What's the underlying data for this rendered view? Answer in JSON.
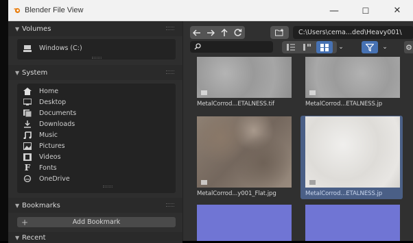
{
  "window": {
    "title": "Blender File View",
    "controls": {
      "minimize": "—",
      "maximize": "☐",
      "close": "✕"
    }
  },
  "sidebar": {
    "volumes": {
      "header": "Volumes",
      "items": [
        {
          "label": "Windows (C:)",
          "icon": "drive-icon"
        }
      ]
    },
    "system": {
      "header": "System",
      "items": [
        {
          "label": "Home",
          "icon": "home-icon"
        },
        {
          "label": "Desktop",
          "icon": "desktop-icon"
        },
        {
          "label": "Documents",
          "icon": "documents-icon"
        },
        {
          "label": "Downloads",
          "icon": "download-icon"
        },
        {
          "label": "Music",
          "icon": "music-icon"
        },
        {
          "label": "Pictures",
          "icon": "pictures-icon"
        },
        {
          "label": "Videos",
          "icon": "videos-icon"
        },
        {
          "label": "Fonts",
          "icon": "fonts-icon"
        },
        {
          "label": "OneDrive",
          "icon": "onedrive-icon"
        }
      ]
    },
    "bookmarks": {
      "header": "Bookmarks",
      "add_label": "Add Bookmark"
    },
    "recent": {
      "header": "Recent"
    }
  },
  "toolbar": {
    "path": "C:\\Users\\cema...ded\\Heavy001\\",
    "search_placeholder": "",
    "display_mode": "thumbnails",
    "accent": "#4772b3"
  },
  "files": [
    {
      "name": "MetalCorrod...ETALNESS.tif",
      "selected": false,
      "texture": "gray-metal"
    },
    {
      "name": "MetalCorrod...ETALNESS.jp",
      "selected": false,
      "texture": "gray-metal"
    },
    {
      "name": "MetalCorrod...y001_Flat.jpg",
      "selected": false,
      "texture": "rusty-metal"
    },
    {
      "name": "MetalCorrod...ETALNESS.jp",
      "selected": true,
      "texture": "white-metal"
    },
    {
      "name": "",
      "selected": false,
      "texture": "normal-map"
    },
    {
      "name": "",
      "selected": false,
      "texture": "normal-map"
    }
  ],
  "colors": {
    "selection": "#4a5f86",
    "normal_map": "#7075d4"
  }
}
